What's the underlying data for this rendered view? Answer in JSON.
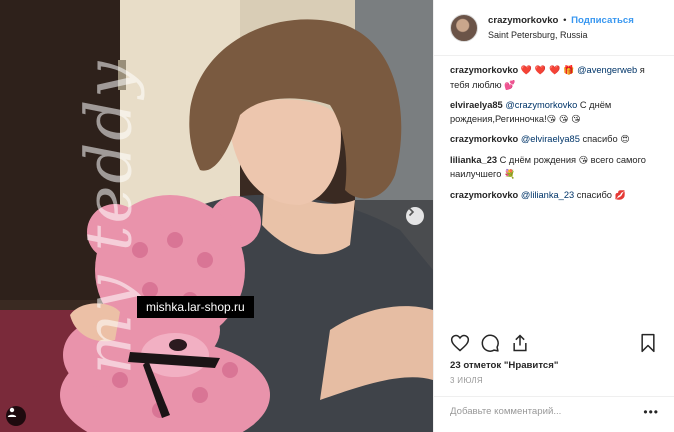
{
  "header": {
    "username": "crazymorkovko",
    "separator": "•",
    "follow_label": "Подписаться",
    "location": "Saint Petersburg, Russia"
  },
  "photo": {
    "watermark": "mishka.lar-shop.ru",
    "side_text": "my teddy",
    "next_icon": "chevron-right-icon",
    "tag_icon": "person-tag-icon"
  },
  "comments": [
    {
      "user": "crazymorkovko",
      "parts": [
        {
          "t": "emoji",
          "v": "❤️ ❤️ ❤️ 🎁 "
        },
        {
          "t": "mention",
          "v": "@avengerweb"
        },
        {
          "t": "text",
          "v": " я тебя люблю "
        },
        {
          "t": "emoji",
          "v": "💕"
        }
      ]
    },
    {
      "user": "elviraelya85",
      "parts": [
        {
          "t": "mention",
          "v": "@crazymorkovko"
        },
        {
          "t": "text",
          "v": " С днём рождения,Регинночка!"
        },
        {
          "t": "emoji",
          "v": "😘 😘 😘"
        }
      ]
    },
    {
      "user": "crazymorkovko",
      "parts": [
        {
          "t": "mention",
          "v": "@elviraelya85"
        },
        {
          "t": "text",
          "v": " спасибо "
        },
        {
          "t": "emoji",
          "v": "😍"
        }
      ]
    },
    {
      "user": "lilianka_23",
      "parts": [
        {
          "t": "text",
          "v": " С днём рождения "
        },
        {
          "t": "emoji",
          "v": "😘"
        },
        {
          "t": "text",
          "v": "   всего самого наилучшего "
        },
        {
          "t": "emoji",
          "v": "💐"
        }
      ]
    },
    {
      "user": "crazymorkovko",
      "parts": [
        {
          "t": "mention",
          "v": "@lilianka_23"
        },
        {
          "t": "text",
          "v": " спасибо "
        },
        {
          "t": "emoji",
          "v": "💋"
        }
      ]
    }
  ],
  "actions": {
    "like_icon": "heart-icon",
    "comment_icon": "comment-icon",
    "share_icon": "share-icon",
    "save_icon": "bookmark-icon"
  },
  "likes_text": "23 отметок \"Нравится\"",
  "date": "3 ИЮЛЯ",
  "add_comment_placeholder": "Добавьте комментарий...",
  "more_label": "•••",
  "colors": {
    "accent": "#3897f0",
    "mention": "#003569",
    "muted": "#999999"
  }
}
